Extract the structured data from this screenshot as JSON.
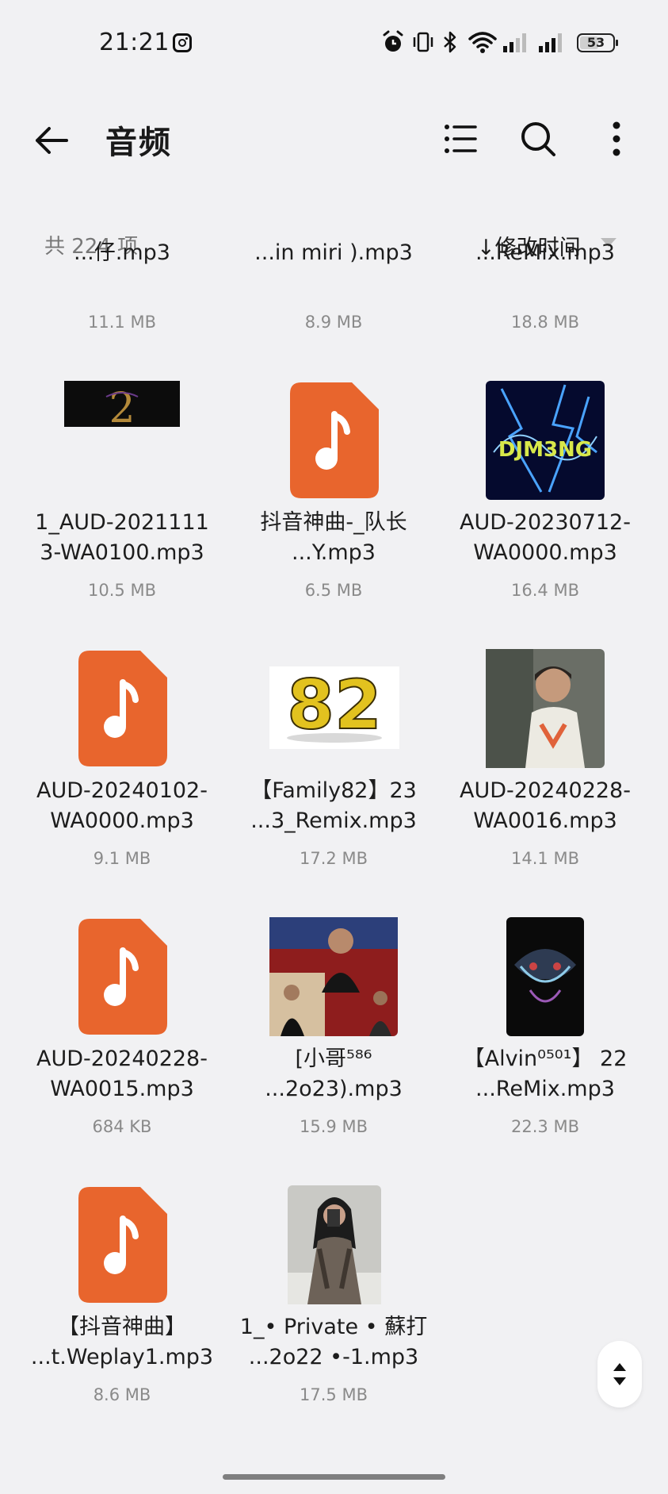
{
  "status_bar": {
    "time": "21:21",
    "battery": "53",
    "icons": [
      "instagram-icon",
      "alarm-icon",
      "vibrate-icon",
      "bluetooth-icon",
      "wifi-icon",
      "signal-icon",
      "signal-icon",
      "battery-icon"
    ]
  },
  "app_bar": {
    "title": "音频",
    "icons": [
      "back-arrow-icon",
      "list-view-icon",
      "search-icon",
      "more-vert-icon"
    ]
  },
  "list_header": {
    "count": "共 224 项",
    "sort": "↓修改时间"
  },
  "colors": {
    "accent": "#e8652d",
    "background": "#f1f1f3"
  },
  "files": [
    {
      "line1": "...仔.mp3",
      "line2": "",
      "size": "11.1 MB",
      "thumb": "none"
    },
    {
      "line1": "...in miri ).mp3",
      "line2": "",
      "size": "8.9 MB",
      "thumb": "none"
    },
    {
      "line1": "...ReMix.mp3",
      "line2": "",
      "size": "18.8 MB",
      "thumb": "none"
    },
    {
      "line1": "1_AUD-2021111",
      "line2": "3-WA0100.mp3",
      "size": "10.5 MB",
      "thumb": "art-dark-logo"
    },
    {
      "line1": "抖音神曲-_队长",
      "line2": "...Y.mp3",
      "size": "6.5 MB",
      "thumb": "music-file-icon"
    },
    {
      "line1": "AUD-20230712-",
      "line2": "WA0000.mp3",
      "size": "16.4 MB",
      "thumb": "art-dj-blue"
    },
    {
      "line1": "AUD-20240102-",
      "line2": "WA0000.mp3",
      "size": "9.1 MB",
      "thumb": "music-file-icon"
    },
    {
      "line1": "【Family82】23",
      "line2": "...3_Remix.mp3",
      "size": "17.2 MB",
      "thumb": "art-82-gold"
    },
    {
      "line1": "AUD-20240228-",
      "line2": "WA0016.mp3",
      "size": "14.1 MB",
      "thumb": "art-boy-photo"
    },
    {
      "line1": "AUD-20240228-",
      "line2": "WA0015.mp3",
      "size": "684 KB",
      "thumb": "music-file-icon"
    },
    {
      "line1": "[小哥⁵⁸⁶",
      "line2": "...2o23).mp3",
      "size": "15.9 MB",
      "thumb": "art-man-red"
    },
    {
      "line1": "【Alvin⁰⁵⁰¹】 22",
      "line2": "...ReMix.mp3",
      "size": "22.3 MB",
      "thumb": "art-dark-skull"
    },
    {
      "line1": "【抖音神曲】",
      "line2": "...t.Weplay1.mp3",
      "size": "8.6 MB",
      "thumb": "music-file-icon"
    },
    {
      "line1": "1_• Private • 蘇打",
      "line2": "...2o22 •-1.mp3",
      "size": "17.5 MB",
      "thumb": "art-woman-photo"
    }
  ]
}
